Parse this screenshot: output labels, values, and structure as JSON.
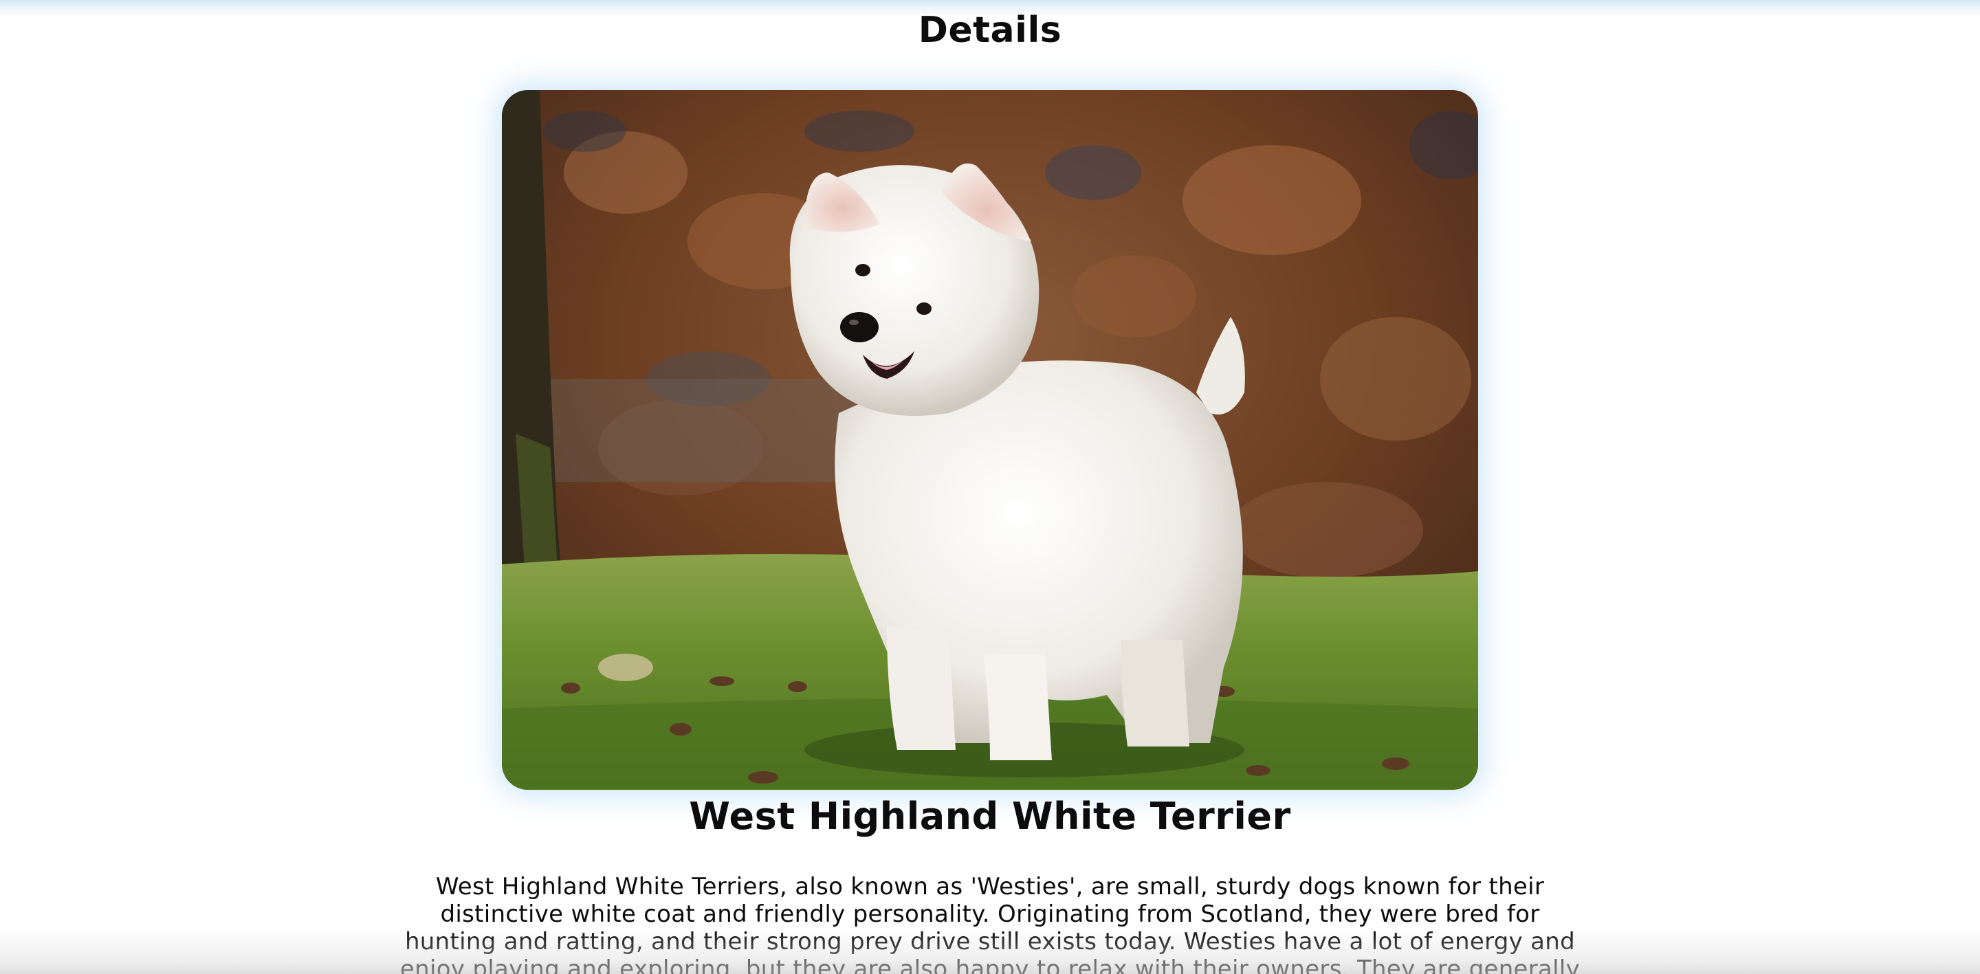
{
  "header": {
    "title": "Details"
  },
  "hero_image": {
    "subject": "west-highland-white-terrier-photo"
  },
  "breed": {
    "name": "West Highland White Terrier",
    "description": "West Highland White Terriers, also known as 'Westies', are small, sturdy dogs known for their distinctive white coat and friendly personality. Originating from Scotland, they were bred for hunting and ratting, and their strong prey drive still exists today. Westies have a lot of energy and enjoy playing and exploring, but they are also happy to relax with their owners. They are generally good with children and can get along with other"
  },
  "colors": {
    "accent_glow": "#96cdf0",
    "text": "#0c0c0c",
    "background": "#ffffff"
  }
}
